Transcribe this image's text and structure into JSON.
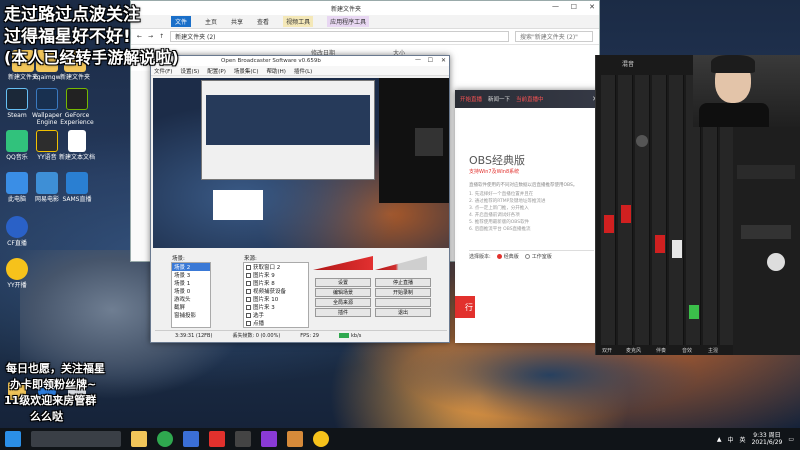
{
  "overlay": {
    "line1": "走过路过点波关注",
    "line2": "过得福星好不好!",
    "line3": "(本人已经转手游解说啦)",
    "bottom1": "每日也愿，关注福星",
    "bottom2": "办卡即领粉丝牌~",
    "bottom3": "11级欢迎来房管群",
    "bottom4": "么么哒"
  },
  "desktop_icons": [
    {
      "label": "新建文件夹"
    },
    {
      "label": "cqaimgw"
    },
    {
      "label": "新建文件夹"
    },
    {
      "label": "Steam"
    },
    {
      "label": "Wallpaper Engine"
    },
    {
      "label": "GeForce Experience"
    },
    {
      "label": "QQ音乐"
    },
    {
      "label": "YY语音"
    },
    {
      "label": "新建文本文档"
    },
    {
      "label": "此电脑"
    },
    {
      "label": "网易电影"
    },
    {
      "label": "SAMS直播"
    },
    {
      "label": "CF直播"
    },
    {
      "label": "YY开播"
    }
  ],
  "explorer": {
    "title": "新建文件夹",
    "tabs": [
      "文件",
      "主页",
      "共享",
      "查看",
      "视频工具",
      "应用程序工具"
    ],
    "path": "新建文件夹 (2)",
    "search_placeholder": "搜索\"新建文件夹 (2)\"",
    "col_modified": "修改日期",
    "col_size": "大小"
  },
  "obs": {
    "title": "Open Broadcaster Software v0.659b",
    "menu": [
      "文件(F)",
      "设置(S)",
      "配置(P)",
      "场景集(C)",
      "帮助(H)",
      "插件(L)"
    ],
    "scenes_header": "场景:",
    "sources_header": "来源:",
    "scenes": [
      "场景 2",
      "场景 3",
      "场景 1",
      "场景 0",
      "游戏头",
      "截屏",
      "窗捕投影"
    ],
    "sources": [
      "获取窗口 2",
      "图片来 9",
      "图片来 8",
      "视频捕获设备",
      "图片来 10",
      "图片来 3",
      "选手",
      "点播",
      "文本来源 3"
    ],
    "buttons": {
      "settings": "设置",
      "stop_live": "停止直播",
      "edit_scene": "编辑场景",
      "start_record": "开始录制",
      "global_sources": "全局来源",
      "plugins": "插件",
      "exit": "退出"
    },
    "status": {
      "time": "3:39:31 (12FB)",
      "dropped": "丢失帧数: 0 (0.00%)",
      "fps_label": "FPS:",
      "fps": "29",
      "bitrate": "kb/s"
    }
  },
  "obs_classic": {
    "tab_live": "开始直播",
    "tab_help": "新闻一下",
    "tab_more": "当前直播中",
    "title": "OBS经典版",
    "subtitle": "支持Win7及Win8系统",
    "desc": "直播软件使用的不同对应数据以后直播推荐使用OBS。",
    "steps": [
      "1. 先选择好一个直播位置并且在",
      "2. 通过推荐的RTMP及键地址等推流进",
      "3. 点一定上新门推，分开推入",
      "4. 开启直播前调试好各项",
      "5. 推荐使用最新版的OBS软件",
      "6. 后面推流平台 OBS直播推流"
    ],
    "version_label": "选择版本:",
    "option_classic": "经典版",
    "option_studio": "工作室版",
    "go_button": "行"
  },
  "mixer": {
    "title": "混音",
    "labels": [
      "双开",
      "麦克风",
      "伴奏",
      "音效",
      "主混"
    ]
  },
  "taskbar": {
    "time": "9:33 周日",
    "date": "2021/6/29",
    "ime": "中",
    "lang": "英"
  },
  "colors": {
    "accent_red": "#e2312d",
    "obs_live_green": "#2fa84f",
    "meter_red": "#d02020"
  }
}
